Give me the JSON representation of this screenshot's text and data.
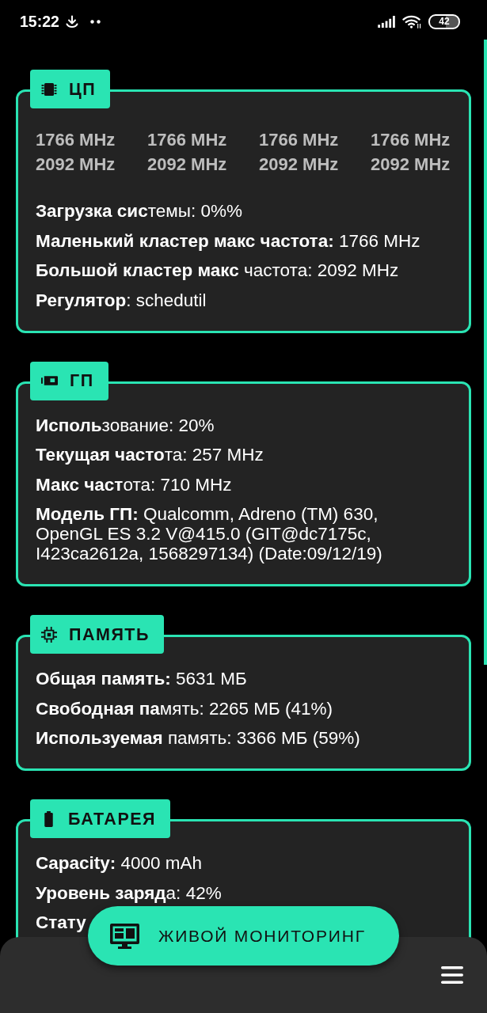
{
  "status_bar": {
    "time": "15:22",
    "battery": "42"
  },
  "sections": [
    {
      "kind": "cpu",
      "title": "ЦП",
      "frequencies": [
        [
          "1766 MHz",
          "1766 MHz",
          "1766 MHz",
          "1766 MHz"
        ],
        [
          "2092 MHz",
          "2092 MHz",
          "2092 MHz",
          "2092 MHz"
        ]
      ],
      "lines": [
        "**Загрузка сис**темы: 0%%",
        "**Маленький кластер макс частота:** 1766 MHz",
        "**Большой кластер макс** частота: 2092 MHz",
        "**Регулятор**: schedutil"
      ]
    },
    {
      "kind": "gpu",
      "title": "ГП",
      "lines": [
        "**Исполь**зование: 20%",
        "**Текущая часто**та: 257 MHz",
        "**Макс част**ота: 710 MHz",
        "**Модель ГП:** Qualcomm, Adreno (TM) 630, OpenGL ES 3.2 V@415.0 (GIT@dc7175c, I423ca2612a, 1568297134) (Date:09/12/19)"
      ]
    },
    {
      "kind": "memory",
      "title": "ПАМЯТЬ",
      "lines": [
        "**Общая память:** 5631 МБ",
        "**Свободная па**мять: 2265 МБ (41%)",
        "**Используемая** память: 3366 МБ (59%)"
      ]
    },
    {
      "kind": "battery",
      "title": "БАТАРЕЯ",
      "lines": [
        "**Capacity:** 4000 mAh",
        "**Уровень заряд**а: 42%",
        "**Стату**"
      ]
    }
  ],
  "bottom_bar": {
    "action_button": "ЖИВОЙ МОНИТОРИНГ"
  }
}
